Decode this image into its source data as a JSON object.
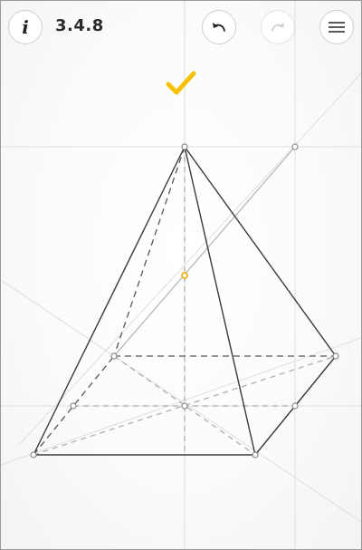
{
  "header": {
    "info_icon": "info-icon",
    "info_glyph": "i",
    "level_number": "3.4.8",
    "undo_icon": "undo-icon",
    "redo_icon": "redo-icon",
    "menu_icon": "menu-icon"
  },
  "status": {
    "solved_icon": "checkmark-icon",
    "color": "#f5c100"
  },
  "colors": {
    "solid_line": "#3a3a3a",
    "hidden_line": "#6a6a6a",
    "light_hidden_line": "#a8a8a8",
    "guide_line": "#dcdcdc",
    "construction_line": "#b0b0b0",
    "highlight_point": "#f0a800"
  }
}
